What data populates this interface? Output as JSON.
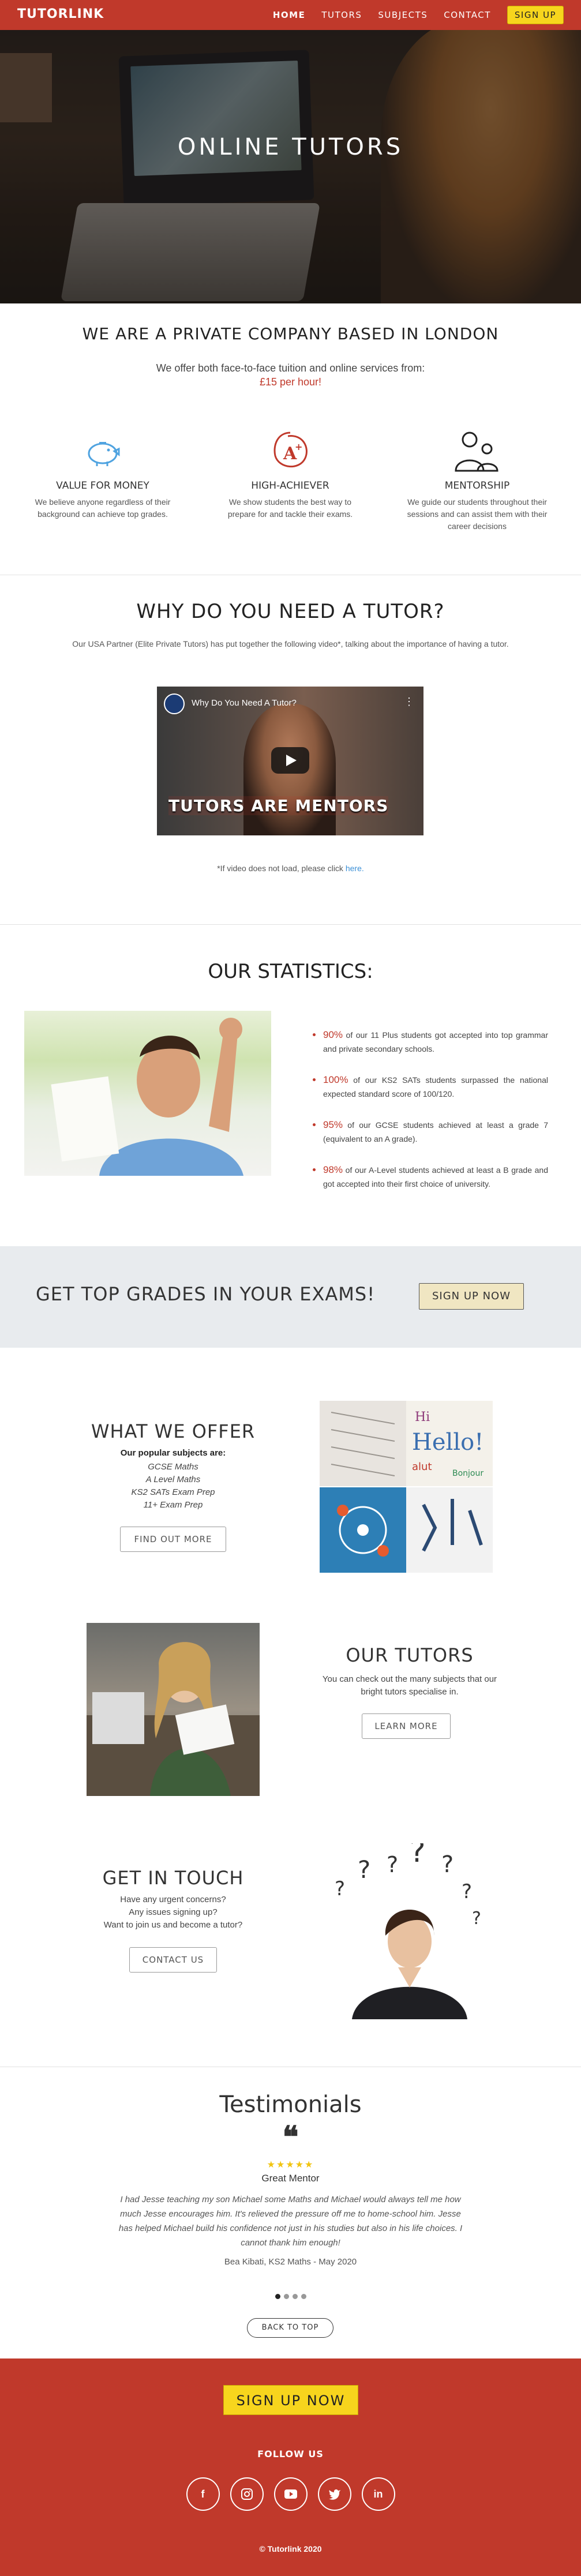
{
  "nav": {
    "logo": "TUTORLINK",
    "items": [
      {
        "label": "HOME",
        "active": true
      },
      {
        "label": "TUTORS",
        "active": false
      },
      {
        "label": "SUBJECTS",
        "active": false
      },
      {
        "label": "CONTACT",
        "active": false
      }
    ],
    "signup": "SIGN UP",
    "accent": "#c0392b",
    "signup_color": "#f7d51d"
  },
  "hero": {
    "title": "ONLINE TUTORS"
  },
  "intro": {
    "title": "WE ARE A PRIVATE COMPANY BASED IN LONDON",
    "text": "We offer both face-to-face tuition and online services from:",
    "price": "£15 per hour!"
  },
  "features": [
    {
      "icon": "piggy-bank-icon",
      "title": "VALUE FOR MONEY",
      "text": "We believe anyone regardless of their background can achieve top grades."
    },
    {
      "icon": "a-plus-grade-icon",
      "title": "HIGH-ACHIEVER",
      "text": "We show students the best way to prepare for and tackle their exams."
    },
    {
      "icon": "mentorship-icon",
      "title": "MENTORSHIP",
      "text": "We guide our students throughout their sessions and can assist them with their career decisions"
    }
  ],
  "why": {
    "title": "WHY DO YOU NEED A TUTOR?",
    "text": "Our USA Partner (Elite Private Tutors) has put together the following video*, talking about the importance of having a tutor.",
    "video_title": "Why Do You Need A Tutor?",
    "video_banner": "TUTORS ARE MENTORS",
    "note": "*If video does not load, please click",
    "note_link": "here."
  },
  "stats": {
    "title": "OUR STATISTICS:",
    "items": [
      {
        "pct": "90%",
        "text": " of our 11 Plus students got accepted into top grammar and private secondary schools."
      },
      {
        "pct": "100%",
        "text": " of our KS2 SATs students surpassed the national expected standard score of 100/120."
      },
      {
        "pct": "95%",
        "text": " of our GCSE students achieved at least a grade 7 (equivalent to an A grade)."
      },
      {
        "pct": "98%",
        "text": " of our A-Level students achieved at least a B grade and got accepted into their first choice of university."
      }
    ]
  },
  "cta": {
    "text": "GET TOP GRADES IN YOUR EXAMS!",
    "button": "SIGN UP NOW"
  },
  "offer": {
    "title": "WHAT WE OFFER",
    "subtitle": "Our popular subjects are:",
    "subjects": [
      "GCSE Maths",
      "A Level Maths",
      "KS2 SATs Exam Prep",
      "11+ Exam Prep"
    ],
    "button": "FIND OUT MORE"
  },
  "tutors": {
    "title": "OUR TUTORS",
    "text": "You can check out the many subjects that our bright tutors specialise in.",
    "button": "LEARN MORE"
  },
  "touch": {
    "title": "GET IN TOUCH",
    "lines": [
      "Have any urgent concerns?",
      "Any issues signing up?",
      "Want to join us and become a tutor?"
    ],
    "button": "CONTACT US"
  },
  "testimonials": {
    "title": "Testimonials",
    "quote_mark": "❝",
    "stars": "★★★★★",
    "heading": "Great Mentor",
    "body": "I had Jesse teaching my son Michael some Maths and Michael would always tell me how much Jesse encourages him. It's relieved the pressure off me to home-school him. Jesse has helped Michael build his confidence not just in his studies but also in his life choices. I cannot thank him enough!",
    "author": "Bea Kibati, KS2 Maths - May 2020",
    "dots": 4,
    "active_dot": 0,
    "back_to_top": "BACK TO TOP"
  },
  "footer": {
    "signup": "SIGN UP NOW",
    "follow": "FOLLOW US",
    "socials": [
      "facebook-icon",
      "instagram-icon",
      "youtube-icon",
      "twitter-icon",
      "linkedin-icon"
    ],
    "copyright": "© Tutorlink 2020"
  }
}
